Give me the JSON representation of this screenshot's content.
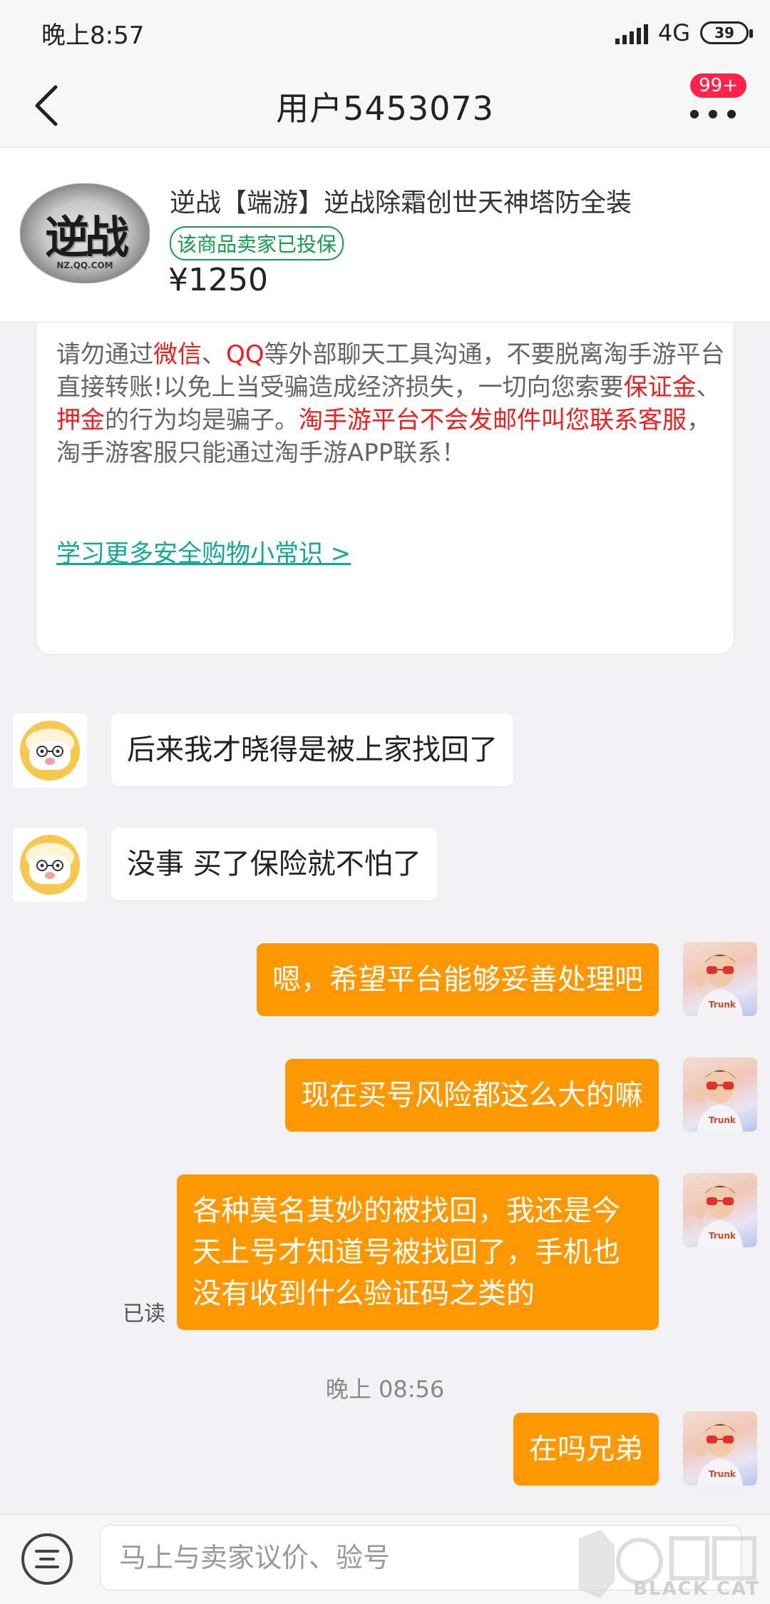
{
  "status_bar": {
    "time": "晚上8:57",
    "network": "4G",
    "battery": "39"
  },
  "nav": {
    "title": "用户5453073",
    "badge": "99+"
  },
  "product": {
    "thumb_text": "逆战",
    "thumb_sub": "NZ.QQ.COM",
    "title": "逆战【端游】逆战除霜创世天神塔防全装",
    "insured": "该商品卖家已投保",
    "price": "¥1250"
  },
  "warning": {
    "seg1": "请勿通过",
    "seg2": "微信",
    "seg3": "、",
    "seg4": "QQ",
    "seg5": "等外部聊天工具沟通，不要脱离淘手游平台直接转账!以免上当受骗造成经济损失，一切向您索要",
    "seg6": "保证金",
    "seg7": "、",
    "seg8": "押金",
    "seg9": "的行为均是骗子。",
    "seg10": "淘手游平台不会发邮件叫您联系客服",
    "seg11": "，淘手游客服只能通过淘手游APP联系！",
    "link": "学习更多安全购物小常识 >"
  },
  "messages": [
    {
      "side": "in",
      "text": "后来我才晓得是被上家找回了"
    },
    {
      "side": "in",
      "text": "没事 买了保险就不怕了"
    },
    {
      "side": "out",
      "text": "嗯，希望平台能够妥善处理吧"
    },
    {
      "side": "out",
      "text": "现在买号风险都这么大的嘛"
    },
    {
      "side": "out",
      "text": "各种莫名其妙的被找回，我还是今天上号才知道号被找回了，手机也没有收到什么验证码之类的"
    },
    {
      "side": "out",
      "text": "在吗兄弟"
    }
  ],
  "read_label": "已读",
  "time_divider": "晚上 08:56",
  "input": {
    "placeholder": "马上与卖家议价、验号"
  },
  "watermark": "BLACK CAT",
  "colors": {
    "accent_orange": "#ff9800",
    "warning_red": "#f21d1d",
    "link_teal": "#12a79a",
    "insured_green": "#10a04a",
    "badge_red": "#ff2448"
  }
}
